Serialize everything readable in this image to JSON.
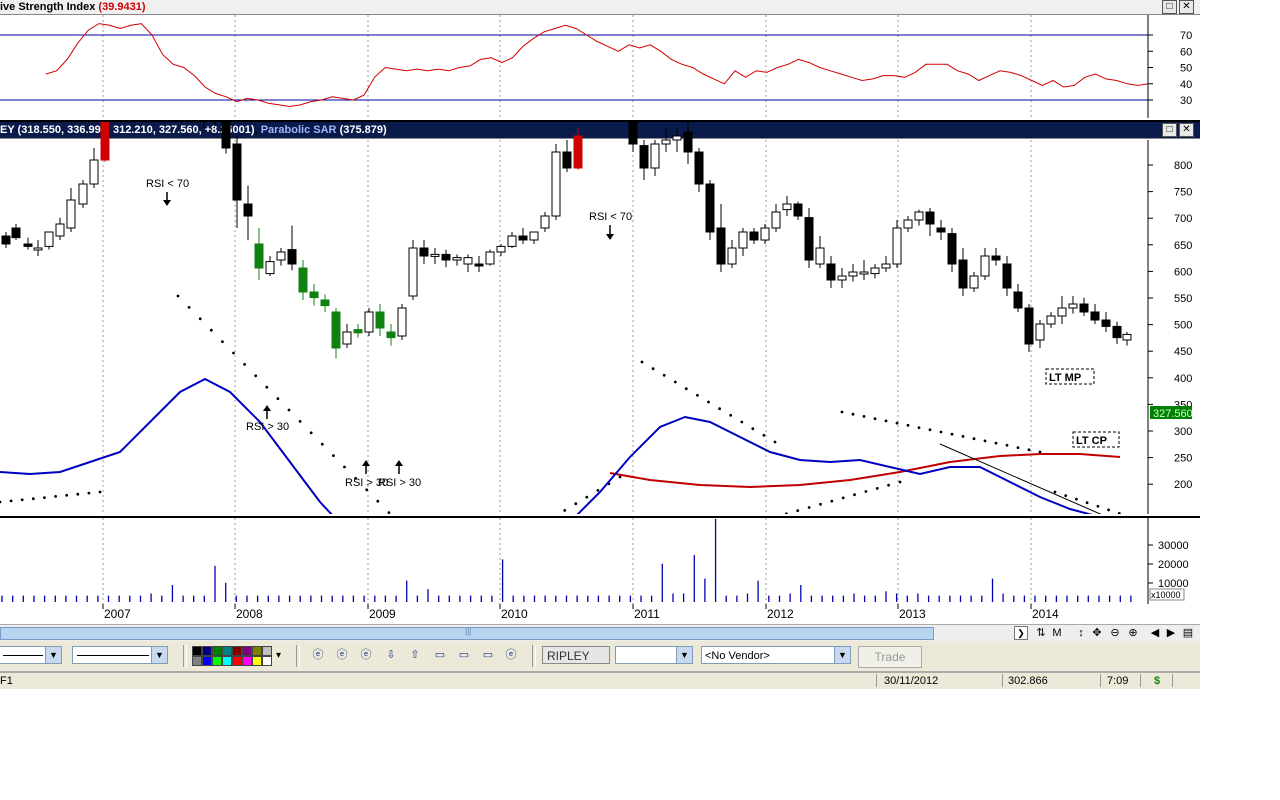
{
  "rsi_pane": {
    "title": "ive Strength Index",
    "value": "(39.9431)",
    "axis_labels": [
      "70",
      "60",
      "50",
      "40",
      "30"
    ],
    "upper_line": 70,
    "lower_line": 30
  },
  "price_pane": {
    "title_symbol": "EY",
    "ohlc": "(318.550, 336.990, 312.210, 327.560, +8.26001)",
    "indicator_name": "Parabolic SAR",
    "indicator_value": "(375.879)",
    "axis_labels": [
      "800",
      "750",
      "700",
      "650",
      "600",
      "550",
      "500",
      "450",
      "400",
      "350",
      "300",
      "250",
      "200"
    ],
    "last_price": "327.560",
    "annotations": [
      "RSI < 70",
      "RSI > 30",
      "RSI > 30",
      "RSI > 30",
      "RSI < 70"
    ],
    "boxes": [
      "LT MP",
      "LT CP"
    ]
  },
  "volume_pane": {
    "axis_labels": [
      "30000",
      "20000",
      "10000"
    ],
    "multiplier": "x10000"
  },
  "time_axis": [
    "2007",
    "2008",
    "2009",
    "2010",
    "2011",
    "2012",
    "2013",
    "2014"
  ],
  "window_buttons": {
    "restore": "□",
    "close": "✕"
  },
  "toolbar": {
    "symbol": "RIPLEY",
    "vendor": "<No Vendor>",
    "trade": "Trade"
  },
  "scroll_icons": [
    "M"
  ],
  "status": {
    "left": "F1",
    "date": "30/11/2012",
    "value": "302.866",
    "time": "7:09",
    "currency": "$"
  },
  "colors": {
    "rsi_line": "#d00000",
    "band_line": "#0000a0",
    "ma_blue": "#0000c0",
    "ma_red": "#c00000",
    "up_candle": "#ffffff",
    "down_candle": "#000000",
    "red_candle": "#d00000",
    "green_candle": "#108010",
    "last_price_bg": "#008000"
  }
}
